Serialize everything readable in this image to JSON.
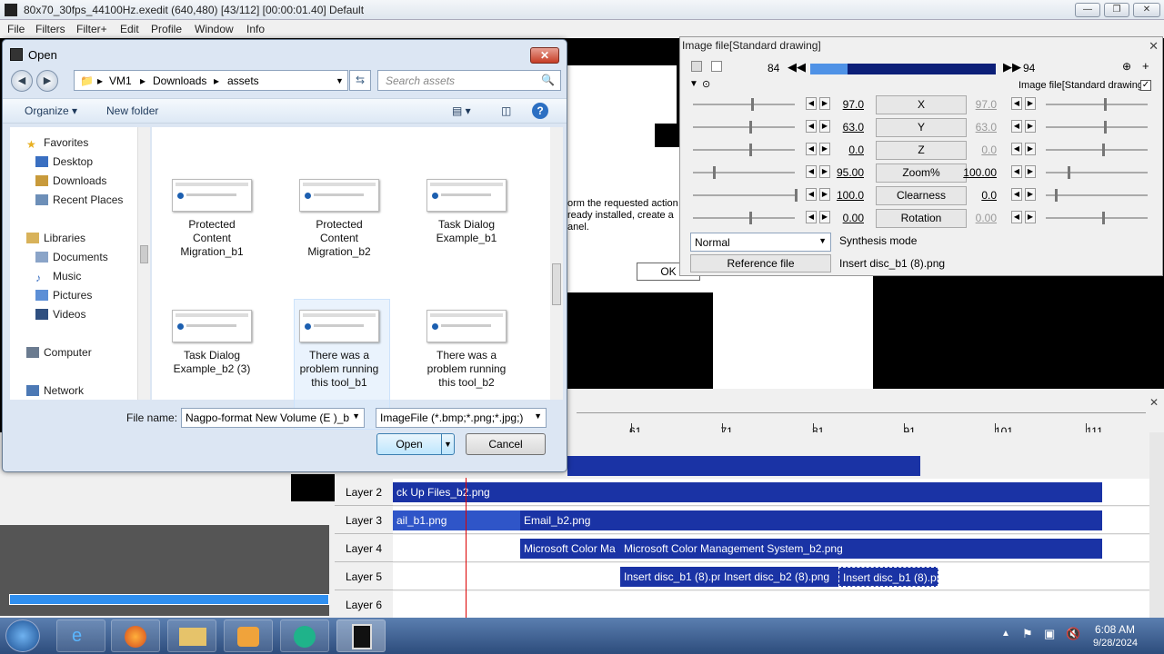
{
  "app": {
    "title": "80x70_30fps_44100Hz.exedit (640,480)  [43/112]  [00:00:01.40]  Default",
    "menu": [
      "File",
      "Filters",
      "Filter+",
      "Edit",
      "Profile",
      "Window",
      "Info"
    ]
  },
  "preview": {
    "text_line1": "orm the requested action",
    "text_line2": "ready installed, create a",
    "text_line3": "anel.",
    "ok_label": "OK"
  },
  "dialog": {
    "title": "Open",
    "address": [
      "VM1",
      "Downloads",
      "assets"
    ],
    "search_placeholder": "Search assets",
    "organize_label": "Organize",
    "new_folder_label": "New folder",
    "nav": {
      "favorites": "Favorites",
      "desktop": "Desktop",
      "downloads": "Downloads",
      "recent": "Recent Places",
      "libraries": "Libraries",
      "documents": "Documents",
      "music": "Music",
      "pictures": "Pictures",
      "videos": "Videos",
      "computer": "Computer",
      "network": "Network"
    },
    "files": [
      {
        "line1": "Protected",
        "line2": "Content",
        "line3": "Migration_b1"
      },
      {
        "line1": "Protected",
        "line2": "Content",
        "line3": "Migration_b2"
      },
      {
        "line1": "Task Dialog",
        "line2": "Example_b1",
        "line3": ""
      },
      {
        "line1": "Task Dialog",
        "line2": "Example_b2 (3)",
        "line3": ""
      },
      {
        "line1": "There was a",
        "line2": "problem running",
        "line3": "this tool_b1"
      },
      {
        "line1": "There was a",
        "line2": "problem running",
        "line3": "this tool_b2"
      }
    ],
    "filename_label": "File name:",
    "filename_value": "Nagpo-format New Volume (E )_b",
    "filetype_value": "ImageFile (*.bmp;*.png;*.jpg;)",
    "open_label": "Open",
    "cancel_label": "Cancel"
  },
  "panel": {
    "title": "Image file[Standard drawing]",
    "frame_start": "84",
    "frame_end": "94",
    "seek_fraction": 0.2,
    "checkbox_label": "Image file[Standard drawing]",
    "rows": [
      {
        "name": "X",
        "left": "97.0",
        "right": "97.0",
        "right_dim": true
      },
      {
        "name": "Y",
        "left": "63.0",
        "right": "63.0",
        "right_dim": true
      },
      {
        "name": "Z",
        "left": "0.0",
        "right": "0.0",
        "right_dim": true
      },
      {
        "name": "Zoom%",
        "left": "95.00",
        "right": "100.00",
        "right_dim": false
      },
      {
        "name": "Clearness",
        "left": "100.0",
        "right": "0.0",
        "right_dim": false
      },
      {
        "name": "Rotation",
        "left": "0.00",
        "right": "0.00",
        "right_dim": true
      }
    ],
    "blend_mode": "Normal",
    "synthesis_label": "Synthesis mode",
    "reference_label": "Reference file",
    "reference_value": "Insert disc_b1 (8).png"
  },
  "timeline": {
    "ticks": [
      "61",
      "71",
      "81",
      "91",
      "101",
      "111"
    ],
    "layers": [
      {
        "label": "Layer 2",
        "clips": [
          {
            "text": "ck Up Files_b2.png",
            "start": 0,
            "width": 780,
            "style": "blue"
          }
        ]
      },
      {
        "label": "Layer 3",
        "clips": [
          {
            "text": "ail_b1.png",
            "start": 0,
            "width": 140,
            "style": "light"
          },
          {
            "text": "Email_b2.png",
            "start": 140,
            "width": 640,
            "style": "blue"
          }
        ]
      },
      {
        "label": "Layer 4",
        "clips": [
          {
            "text": "Microsoft Color Ma",
            "start": 140,
            "width": 110,
            "style": "blue"
          },
          {
            "text": "Microsoft Color Management System_b2.png",
            "start": 250,
            "width": 530,
            "style": "blue"
          }
        ]
      },
      {
        "label": "Layer 5",
        "clips": [
          {
            "text": "Insert disc_b1 (8).pn",
            "start": 250,
            "width": 110,
            "style": "blue"
          },
          {
            "text": "Insert disc_b2 (8).png",
            "start": 360,
            "width": 130,
            "style": "blue"
          },
          {
            "text": "Insert disc_b1 (8).pn",
            "start": 490,
            "width": 110,
            "style": "sel"
          }
        ]
      },
      {
        "label": "Layer 6",
        "clips": []
      }
    ]
  },
  "taskbar": {
    "time": "6:08 AM",
    "date": "9/28/2024"
  }
}
